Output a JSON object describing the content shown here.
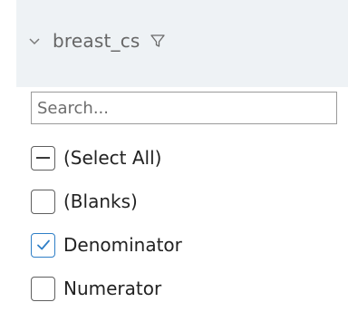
{
  "header": {
    "title": "breast_cs",
    "chevron_icon": "chevron-down-icon",
    "filter_icon": "filter-icon"
  },
  "search": {
    "placeholder": "Search...",
    "value": ""
  },
  "items": [
    {
      "label": "(Select All)",
      "state": "indeterminate"
    },
    {
      "label": "(Blanks)",
      "state": "unchecked"
    },
    {
      "label": "Denominator",
      "state": "checked"
    },
    {
      "label": "Numerator",
      "state": "unchecked"
    }
  ],
  "colors": {
    "header_bg": "#eef2f5",
    "check_accent": "#2f7fc7"
  }
}
